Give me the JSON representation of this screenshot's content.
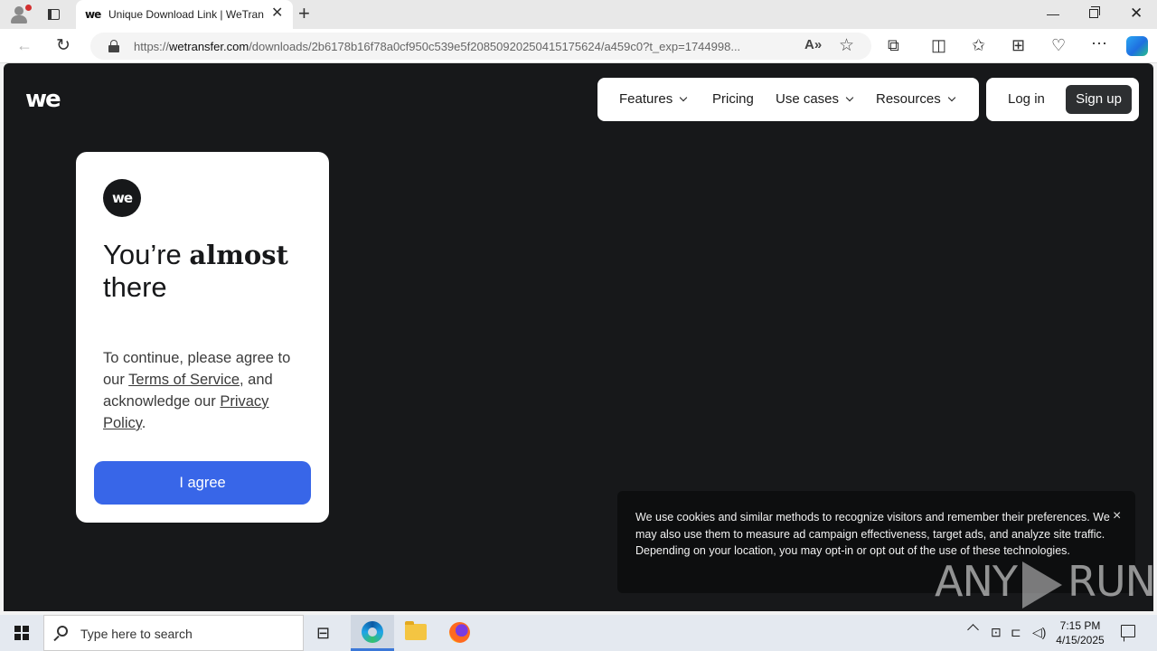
{
  "browser": {
    "tab_title": "Unique Download Link | WeTransfer",
    "tab_favicon": "we",
    "url_host": "wetransfer.com",
    "url_prefix": "https://",
    "url_path": "/downloads/2b6178b16f78a0cf950c539e5f20850920250415175624/a459c0?t_exp=1744998...",
    "icons": [
      "profile-icon",
      "tab-actions-icon",
      "close-tab-icon",
      "new-tab-icon",
      "back-icon",
      "reload-icon",
      "lock-icon",
      "read-aloud-icon",
      "favorite-star-icon",
      "extensions-icon",
      "split-screen-icon",
      "favorites-icon",
      "collections-icon",
      "browser-essentials-icon",
      "more-menu-icon",
      "copilot-icon"
    ]
  },
  "site": {
    "logo": "we",
    "nav": {
      "features": "Features",
      "pricing": "Pricing",
      "use_cases": "Use cases",
      "resources": "Resources",
      "login": "Log in",
      "signup": "Sign up"
    },
    "card": {
      "logo": "we",
      "headline_prefix": "You’re ",
      "headline_bold": "almost",
      "headline_suffix": "there",
      "body_1": "To continue, please agree to our ",
      "terms_link": "Terms of Service",
      "body_2": ", and acknowledge our ",
      "privacy_link": "Privacy Policy",
      "body_3": ".",
      "agree_button": "I agree"
    },
    "cookie": {
      "text": "We use cookies and similar methods to recognize visitors and remember their preferences. We may also use them to measure ad campaign effectiveness, target ads, and analyze site traffic. Depending on your location, you may opt-in or opt out of the use of these technologies.",
      "close": "×"
    },
    "watermark_left": "ANY",
    "watermark_right": "RUN"
  },
  "taskbar": {
    "search_placeholder": "Type here to search",
    "time": "7:15 PM",
    "date": "4/15/2025"
  },
  "colors": {
    "page_bg": "#17181a",
    "agree_button": "#3866e8",
    "signup_button": "#2d2f31"
  }
}
